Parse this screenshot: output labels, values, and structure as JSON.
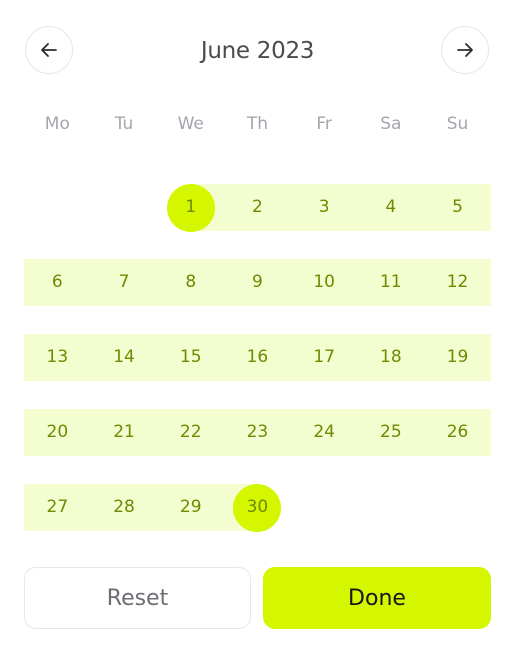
{
  "header": {
    "month_title": "June 2023",
    "prev_icon": "arrow-left-icon",
    "next_icon": "arrow-right-icon"
  },
  "weekdays": [
    "Mo",
    "Tu",
    "We",
    "Th",
    "Fr",
    "Sa",
    "Su"
  ],
  "days": [
    "1",
    "2",
    "3",
    "4",
    "5",
    "6",
    "7",
    "8",
    "9",
    "10",
    "11",
    "12",
    "13",
    "14",
    "15",
    "16",
    "17",
    "18",
    "19",
    "20",
    "21",
    "22",
    "23",
    "24",
    "25",
    "26",
    "27",
    "28",
    "29",
    "30"
  ],
  "selection": {
    "start_day": "1",
    "end_day": "30"
  },
  "actions": {
    "reset_label": "Reset",
    "done_label": "Done"
  },
  "colors": {
    "accent": "#d4f700",
    "range_fill": "#f3fdcf",
    "day_text": "#6f8a00",
    "weekday_text": "#a3a6ad"
  }
}
